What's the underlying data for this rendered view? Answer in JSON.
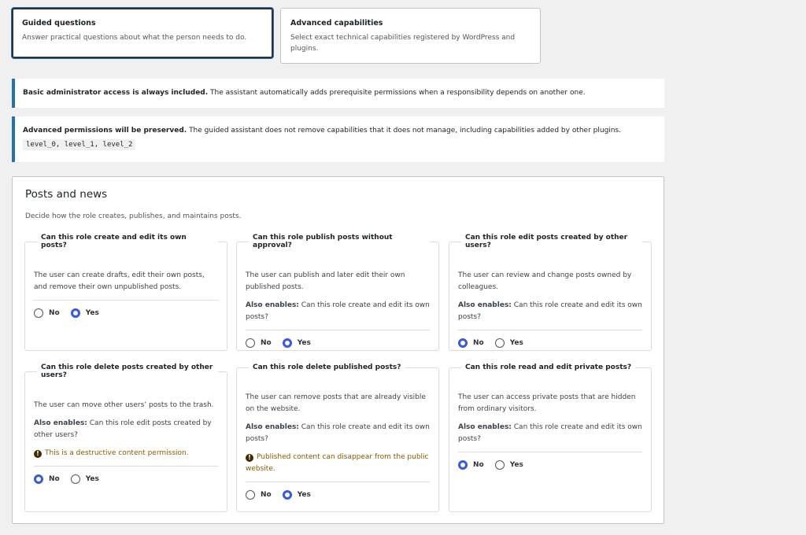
{
  "modes": [
    {
      "title": "Guided questions",
      "description": "Answer practical questions about what the person needs to do.",
      "selected": true
    },
    {
      "title": "Advanced capabilities",
      "description": "Select exact technical capabilities registered by WordPress and plugins.",
      "selected": false
    }
  ],
  "notices": {
    "admin": {
      "strong": "Basic administrator access is always included.",
      "text": " The assistant automatically adds prerequisite permissions when a responsibility depends on another one."
    },
    "preserved": {
      "strong": "Advanced permissions will be preserved.",
      "text": " The guided assistant does not remove capabilities that it does not manage, including capabilities added by other plugins.",
      "code": "level_0, level_1, level_2"
    }
  },
  "section": {
    "title": "Posts and news",
    "description": "Decide how the role creates, publishes, and maintains posts."
  },
  "labels": {
    "also_enables": "Also enables:",
    "no": "No",
    "yes": "Yes"
  },
  "questions": [
    {
      "legend": "Can this role create and edit its own posts?",
      "description": "The user can create drafts, edit their own posts, and remove their own unpublished posts.",
      "also": "",
      "warning": "",
      "answer": "Yes"
    },
    {
      "legend": "Can this role publish posts without approval?",
      "description": "The user can publish and later edit their own published posts.",
      "also": " Can this role create and edit its own posts?",
      "warning": "",
      "answer": "Yes"
    },
    {
      "legend": "Can this role edit posts created by other users?",
      "description": "The user can review and change posts owned by colleagues.",
      "also": " Can this role create and edit its own posts?",
      "warning": "",
      "answer": "No"
    },
    {
      "legend": "Can this role delete posts created by other users?",
      "description": "The user can move other users’ posts to the trash.",
      "also": " Can this role edit posts created by other users?",
      "warning": "This is a destructive content permission.",
      "answer": "No"
    },
    {
      "legend": "Can this role delete published posts?",
      "description": "The user can remove posts that are already visible on the website.",
      "also": " Can this role create and edit its own posts?",
      "warning": "Published content can disappear from the public website.",
      "answer": "Yes"
    },
    {
      "legend": "Can this role read and edit private posts?",
      "description": "The user can access private posts that are hidden from ordinary visitors.",
      "also": " Can this role create and edit its own posts?",
      "warning": "",
      "answer": "No"
    }
  ]
}
